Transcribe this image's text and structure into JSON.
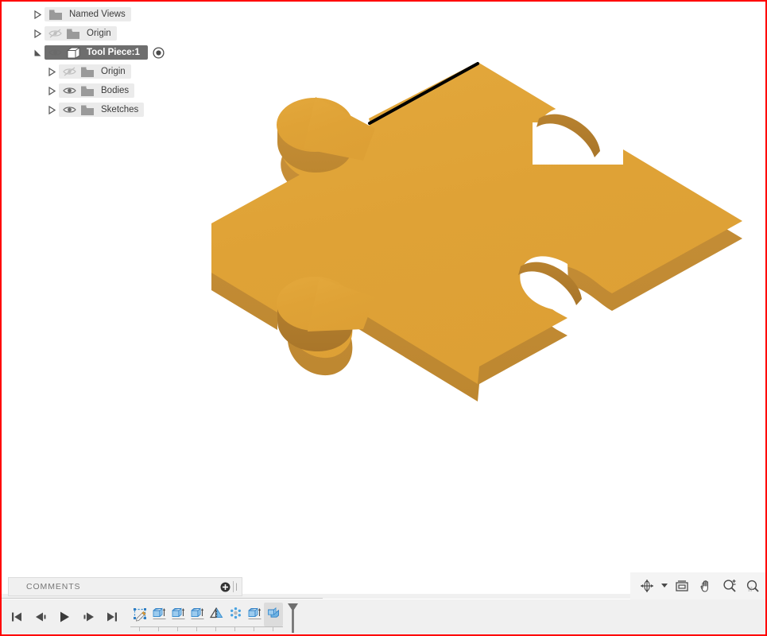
{
  "app": {
    "accent_red": "#ff0000",
    "model_color": "#e0a338",
    "model_side_color": "#c79036",
    "highlight_edge_color": "#000000",
    "viewport_background": "#ffffff",
    "panel_background": "#f0f0f0",
    "row_background": "#ebebeb",
    "selection_background": "#6e6e6e"
  },
  "browser": {
    "items": [
      {
        "label": "Named Views",
        "icon": "folder-icon",
        "expander": "collapsed-arrow-icon",
        "indent": 0,
        "has_eye": false,
        "eye": "none",
        "selected": false,
        "has_target": false
      },
      {
        "label": "Origin",
        "icon": "folder-icon",
        "expander": "collapsed-arrow-icon",
        "indent": 0,
        "has_eye": true,
        "eye": "eye-hidden-icon",
        "selected": false,
        "has_target": false
      },
      {
        "label": "Tool Piece:1",
        "icon": "component-icon",
        "expander": "expanded-arrow-icon",
        "indent": 0,
        "has_eye": true,
        "eye": "eye-visible-icon",
        "selected": true,
        "has_target": true
      },
      {
        "label": "Origin",
        "icon": "folder-icon",
        "expander": "collapsed-arrow-icon",
        "indent": 1,
        "has_eye": true,
        "eye": "eye-hidden-icon",
        "selected": false,
        "has_target": false
      },
      {
        "label": "Bodies",
        "icon": "folder-icon",
        "expander": "collapsed-arrow-icon",
        "indent": 1,
        "has_eye": true,
        "eye": "eye-visible-icon",
        "selected": false,
        "has_target": false
      },
      {
        "label": "Sketches",
        "icon": "folder-icon",
        "expander": "collapsed-arrow-icon",
        "indent": 1,
        "has_eye": true,
        "eye": "eye-visible-icon",
        "selected": false,
        "has_target": false
      }
    ]
  },
  "comments": {
    "title": "COMMENTS",
    "add_label": "+",
    "add_icon": "plus-circle-icon",
    "grip_icon": "resize-grip-icon"
  },
  "timeline": {
    "playback": [
      {
        "name": "go-to-beginning-button",
        "icon": "skip-to-start-icon"
      },
      {
        "name": "step-backward-button",
        "icon": "step-back-icon"
      },
      {
        "name": "play-button",
        "icon": "play-icon"
      },
      {
        "name": "step-forward-button",
        "icon": "step-forward-icon"
      },
      {
        "name": "go-to-end-button",
        "icon": "skip-to-end-icon"
      }
    ],
    "features": [
      {
        "name": "timeline-item-sketch",
        "icon": "sketch-icon",
        "label": "Sketch",
        "active": false
      },
      {
        "name": "timeline-item-extrude-1",
        "icon": "extrude-icon",
        "label": "Extrude",
        "active": false
      },
      {
        "name": "timeline-item-extrude-2",
        "icon": "extrude-icon",
        "label": "Extrude",
        "active": false
      },
      {
        "name": "timeline-item-extrude-3",
        "icon": "extrude-icon",
        "label": "Extrude",
        "active": false
      },
      {
        "name": "timeline-item-mirror",
        "icon": "mirror-icon",
        "label": "Mirror",
        "active": false
      },
      {
        "name": "timeline-item-circular-pattern",
        "icon": "circular-pattern-icon",
        "label": "Circular Pattern",
        "active": false
      },
      {
        "name": "timeline-item-extrude-4",
        "icon": "extrude-icon",
        "label": "Extrude",
        "active": false
      },
      {
        "name": "timeline-item-combine",
        "icon": "combine-icon",
        "label": "Combine",
        "active": true
      }
    ],
    "end_marker": {
      "name": "timeline-end-marker",
      "icon": "timeline-marker-icon"
    }
  },
  "navbar": {
    "buttons": [
      {
        "name": "orbit-button",
        "icon": "orbit-icon",
        "has_caret": true
      },
      {
        "name": "look-at-button",
        "icon": "look-at-icon",
        "has_caret": false
      },
      {
        "name": "pan-button",
        "icon": "pan-hand-icon",
        "has_caret": false
      },
      {
        "name": "zoom-button",
        "icon": "zoom-icon",
        "has_caret": false
      },
      {
        "name": "fit-button",
        "icon": "fit-icon",
        "has_caret": false
      }
    ]
  },
  "model": {
    "name": "puzzle-piece-body",
    "description": "Isometric extruded jigsaw puzzle piece",
    "selected_edge": "top-right-upper-edge"
  }
}
